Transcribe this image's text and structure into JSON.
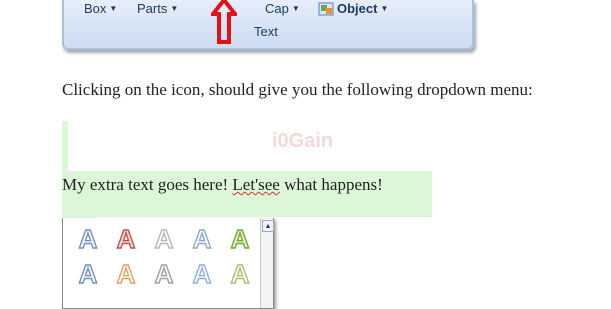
{
  "ribbon": {
    "buttons": [
      {
        "label": "Box",
        "icon": "chevron-down-icon"
      },
      {
        "label": "Parts",
        "icon": "chevron-down-icon"
      },
      {
        "label": "Cap",
        "icon": "chevron-down-icon"
      },
      {
        "label": "Object",
        "icon": "chevron-down-icon"
      }
    ],
    "group_label": "Text",
    "annotation_color": "#e3101a"
  },
  "content": {
    "instruction": "Clicking on the icon, should give you the following dropdown menu:",
    "extra_text_1": "My extra text goes here! ",
    "extra_text_misspelled": "Let'see",
    "extra_text_2": " what happens!",
    "highlight_color": "#dcf6d8"
  },
  "gallery": {
    "styles": [
      {
        "name": "wordart-style-1",
        "glyph": "A",
        "color": "#6f8fc0"
      },
      {
        "name": "wordart-style-2",
        "glyph": "A",
        "color": "#c05050"
      },
      {
        "name": "wordart-style-3",
        "glyph": "A",
        "color": "#b8b8b8"
      },
      {
        "name": "wordart-style-4",
        "glyph": "A",
        "color": "#8fa8cf"
      },
      {
        "name": "wordart-style-5",
        "glyph": "A",
        "color": "#7aa82e"
      },
      {
        "name": "wordart-style-6",
        "glyph": "A",
        "color": "#6f8fc0"
      },
      {
        "name": "wordart-style-7",
        "glyph": "A",
        "color": "#e0a060"
      },
      {
        "name": "wordart-style-8",
        "glyph": "A",
        "color": "#a0a0a0"
      },
      {
        "name": "wordart-style-9",
        "glyph": "A",
        "color": "#8fb0d8"
      },
      {
        "name": "wordart-style-10",
        "glyph": "A",
        "color": "#a8c070"
      }
    ]
  }
}
